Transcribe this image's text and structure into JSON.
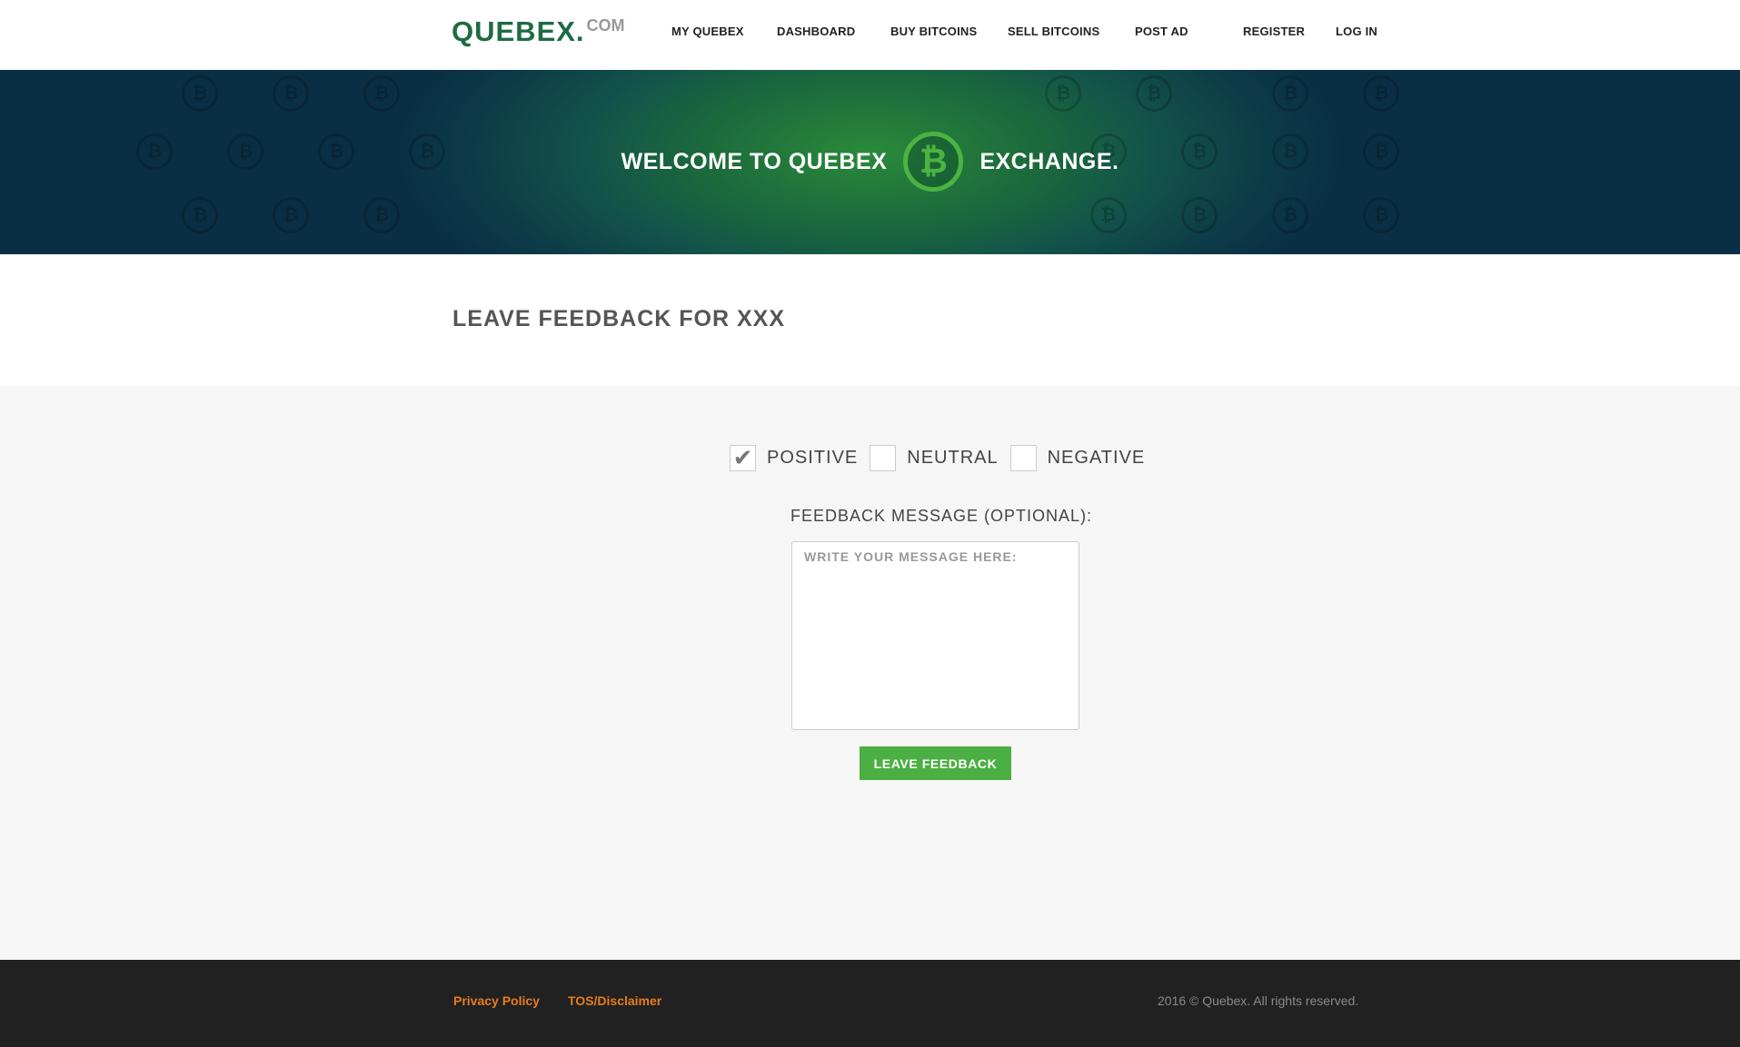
{
  "header": {
    "logo_main": "QUEBEX.",
    "logo_suffix": "COM",
    "nav": {
      "my_quebex": "MY QUEBEX",
      "dashboard": "DASHBOARD",
      "buy_bitcoins": "BUY BITCOINS",
      "sell_bitcoins": "SELL BITCOINS",
      "post_ad": "POST AD",
      "register": "REGISTER",
      "log_in": "LOG IN"
    }
  },
  "banner": {
    "text_left": "WELCOME TO QUEBEX",
    "text_right": "EXCHANGE.",
    "icon": "bitcoin-icon",
    "bitcoin_symbol": "₿"
  },
  "page": {
    "title": "LEAVE FEEDBACK FOR XXX"
  },
  "form": {
    "ratings": [
      {
        "label": "POSITIVE",
        "checked": true
      },
      {
        "label": "NEUTRAL",
        "checked": false
      },
      {
        "label": "NEGATIVE",
        "checked": false
      }
    ],
    "message_label": "FEEDBACK MESSAGE (OPTIONAL):",
    "message_placeholder": "WRITE YOUR MESSAGE HERE:",
    "message_value": "",
    "submit_label": "LEAVE FEEDBACK"
  },
  "footer": {
    "privacy": "Privacy Policy",
    "tos": "TOS/Disclaimer",
    "copyright": "2016 © Quebex. All rights reserved."
  },
  "colors": {
    "brand_green": "#1f6b42",
    "accent_green": "#4caf43",
    "footer_bg": "#212121",
    "footer_link": "#e87c1d"
  }
}
